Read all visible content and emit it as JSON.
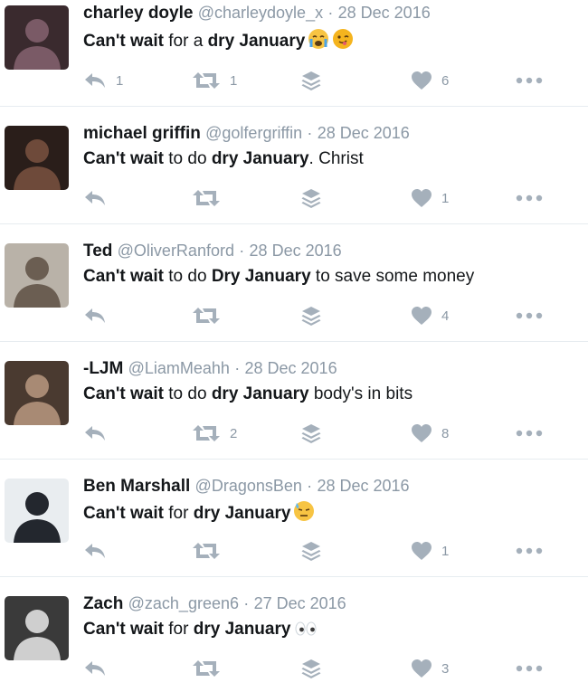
{
  "tweets": [
    {
      "name": "charley doyle",
      "handle": "@charleydoyle_x",
      "separator": "·",
      "date": "28 Dec 2016",
      "text_parts": [
        {
          "text": "Can't wait",
          "bold": true
        },
        {
          "text": " for a ",
          "bold": false
        },
        {
          "text": "dry January",
          "bold": true
        }
      ],
      "emojis": [
        "crying-face-icon",
        "winking-tongue-face-icon"
      ],
      "counts": {
        "reply": "1",
        "retweet": "1",
        "like": "6"
      },
      "avatar_colors": [
        "#3a2a2e",
        "#7a5a66"
      ]
    },
    {
      "name": "michael griffin",
      "handle": "@golfergriffin",
      "separator": "·",
      "date": "28 Dec 2016",
      "text_parts": [
        {
          "text": "Can't wait",
          "bold": true
        },
        {
          "text": " to do ",
          "bold": false
        },
        {
          "text": "dry January",
          "bold": true
        },
        {
          "text": ". Christ",
          "bold": false
        }
      ],
      "emojis": [],
      "counts": {
        "reply": "",
        "retweet": "",
        "like": "1"
      },
      "avatar_colors": [
        "#2a1e1a",
        "#6e4a3a"
      ]
    },
    {
      "name": "Ted",
      "handle": "@OliverRanford",
      "separator": "·",
      "date": "28 Dec 2016",
      "text_parts": [
        {
          "text": "Can't wait",
          "bold": true
        },
        {
          "text": " to do ",
          "bold": false
        },
        {
          "text": "Dry January",
          "bold": true
        },
        {
          "text": " to save some money",
          "bold": false
        }
      ],
      "emojis": [],
      "counts": {
        "reply": "",
        "retweet": "",
        "like": "4"
      },
      "avatar_colors": [
        "#b9b2a8",
        "#6b5e52"
      ]
    },
    {
      "name": "-LJM",
      "handle": "@LiamMeahh",
      "separator": "·",
      "date": "28 Dec 2016",
      "text_parts": [
        {
          "text": "Can't wait",
          "bold": true
        },
        {
          "text": " to do ",
          "bold": false
        },
        {
          "text": "dry January",
          "bold": true
        },
        {
          "text": " body's in bits",
          "bold": false
        }
      ],
      "emojis": [],
      "counts": {
        "reply": "",
        "retweet": "2",
        "like": "8"
      },
      "avatar_colors": [
        "#4a3a30",
        "#a88a74"
      ]
    },
    {
      "name": "Ben Marshall",
      "handle": "@DragonsBen",
      "separator": "·",
      "date": "28 Dec 2016",
      "text_parts": [
        {
          "text": "Can't wait",
          "bold": true
        },
        {
          "text": " for ",
          "bold": false
        },
        {
          "text": "dry January",
          "bold": true
        }
      ],
      "emojis": [
        "sweat-face-icon"
      ],
      "counts": {
        "reply": "",
        "retweet": "",
        "like": "1"
      },
      "avatar_colors": [
        "#e9edf0",
        "#23272e"
      ]
    },
    {
      "name": "Zach",
      "handle": "@zach_green6",
      "separator": "·",
      "date": "27 Dec 2016",
      "text_parts": [
        {
          "text": "Can't wait",
          "bold": true
        },
        {
          "text": " for ",
          "bold": false
        },
        {
          "text": "dry January",
          "bold": true
        }
      ],
      "emojis": [
        "eyes-icon"
      ],
      "counts": {
        "reply": "",
        "retweet": "",
        "like": "3"
      },
      "avatar_colors": [
        "#3a3a3a",
        "#cfcfcf"
      ]
    }
  ],
  "colors": {
    "icon": "#a5b0bb",
    "muted_text": "#8b98a5",
    "divider": "#e6ecf0"
  }
}
